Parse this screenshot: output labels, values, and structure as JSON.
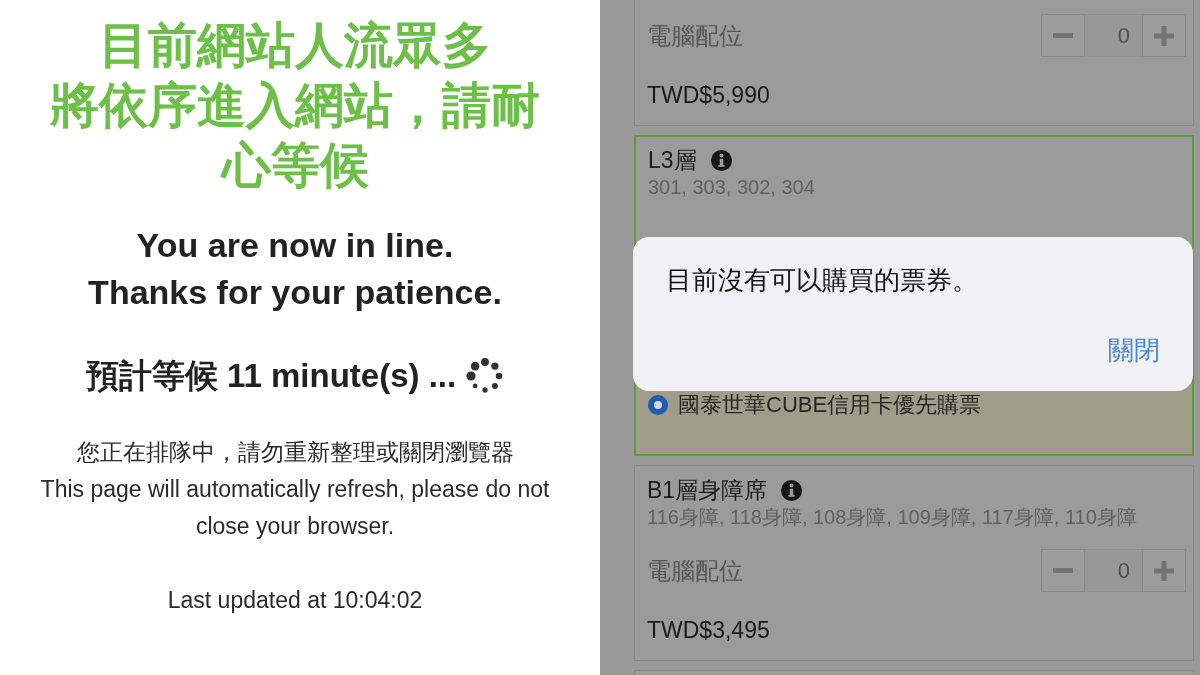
{
  "queue_notice": {
    "title_lines": [
      "目前網站人流眾多",
      "將依序進入網站，請耐心等候"
    ],
    "status_lines": [
      "You are now in line.",
      "Thanks for your patience."
    ],
    "wait_estimate": "預計等候 11 minute(s) ...",
    "notice_zh": "您正在排隊中，請勿重新整理或關閉瀏覽器",
    "notice_en": "This page will automatically refresh, please do not close your browser.",
    "last_updated": "Last updated at 10:04:02"
  },
  "ticket_page": {
    "sections": [
      {
        "selected": false,
        "seat_type": "電腦配位",
        "quantity": "0",
        "price": "TWD$5,990"
      },
      {
        "selected": true,
        "title": "L3層",
        "areas": "301, 303, 302, 304",
        "option": {
          "label": "國泰世華CUBE信用卡優先購票",
          "selected": true
        }
      },
      {
        "selected": false,
        "title": "B1層身障席",
        "areas": "116身障, 118身障, 108身障, 109身障, 117身障, 110身障",
        "seat_type": "電腦配位",
        "quantity": "0",
        "price": "TWD$3,495"
      }
    ],
    "alert": {
      "message": "目前沒有可以購買的票券。",
      "buttons": [
        "關閉"
      ]
    }
  }
}
